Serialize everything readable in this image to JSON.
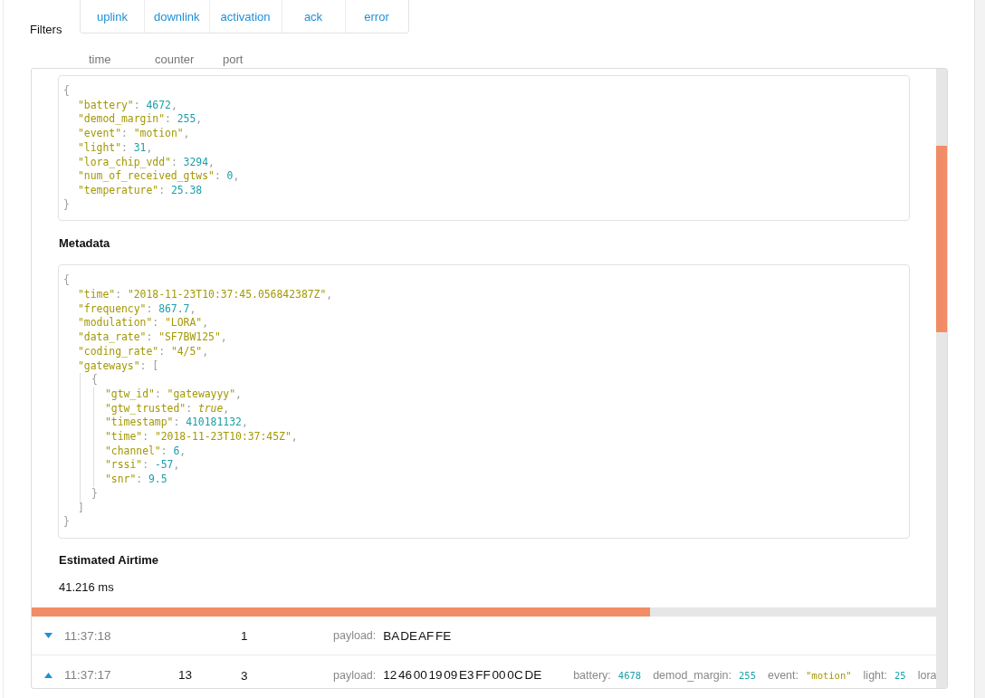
{
  "filters_label": "Filters",
  "filters": [
    {
      "label": "uplink",
      "selected": false
    },
    {
      "label": "downlink",
      "selected": false
    },
    {
      "label": "activation",
      "selected": false
    },
    {
      "label": "ack",
      "selected": false
    },
    {
      "label": "error",
      "selected": false
    }
  ],
  "columns": [
    "time",
    "counter",
    "port"
  ],
  "detail": {
    "payload_code": [
      {
        "tokens": [
          {
            "kind": "punct",
            "text": "{"
          }
        ]
      },
      {
        "children": [
          {
            "tokens": [
              {
                "kind": "key",
                "text": "\"battery\""
              },
              {
                "kind": "punct",
                "text": ": "
              },
              {
                "kind": "number",
                "text": "4672"
              },
              {
                "kind": "punct",
                "text": ","
              }
            ]
          },
          {
            "tokens": [
              {
                "kind": "key",
                "text": "\"demod_margin\""
              },
              {
                "kind": "punct",
                "text": ": "
              },
              {
                "kind": "number",
                "text": "255"
              },
              {
                "kind": "punct",
                "text": ","
              }
            ]
          },
          {
            "tokens": [
              {
                "kind": "key",
                "text": "\"event\""
              },
              {
                "kind": "punct",
                "text": ": "
              },
              {
                "kind": "string",
                "text": "\"motion\""
              },
              {
                "kind": "punct",
                "text": ","
              }
            ]
          },
          {
            "tokens": [
              {
                "kind": "key",
                "text": "\"light\""
              },
              {
                "kind": "punct",
                "text": ": "
              },
              {
                "kind": "number",
                "text": "31"
              },
              {
                "kind": "punct",
                "text": ","
              }
            ]
          },
          {
            "tokens": [
              {
                "kind": "key",
                "text": "\"lora_chip_vdd\""
              },
              {
                "kind": "punct",
                "text": ": "
              },
              {
                "kind": "number",
                "text": "3294"
              },
              {
                "kind": "punct",
                "text": ","
              }
            ]
          },
          {
            "tokens": [
              {
                "kind": "key",
                "text": "\"num_of_received_gtws\""
              },
              {
                "kind": "punct",
                "text": ": "
              },
              {
                "kind": "number",
                "text": "0"
              },
              {
                "kind": "punct",
                "text": ","
              }
            ]
          },
          {
            "tokens": [
              {
                "kind": "key",
                "text": "\"temperature\""
              },
              {
                "kind": "punct",
                "text": ": "
              },
              {
                "kind": "number",
                "text": "25.38"
              }
            ]
          }
        ]
      },
      {
        "tokens": [
          {
            "kind": "punct",
            "text": "}"
          }
        ]
      }
    ],
    "metadata": {
      "heading": "Metadata",
      "code": [
        {
          "tokens": [
            {
              "kind": "punct",
              "text": "{"
            }
          ]
        },
        {
          "children": [
            {
              "tokens": [
                {
                  "kind": "key",
                  "text": "\"time\""
                },
                {
                  "kind": "punct",
                  "text": ": "
                },
                {
                  "kind": "string",
                  "text": "\"2018-11-23T10:37:45.056842387Z\""
                },
                {
                  "kind": "punct",
                  "text": ","
                }
              ]
            },
            {
              "tokens": [
                {
                  "kind": "key",
                  "text": "\"frequency\""
                },
                {
                  "kind": "punct",
                  "text": ": "
                },
                {
                  "kind": "number",
                  "text": "867.7"
                },
                {
                  "kind": "punct",
                  "text": ","
                }
              ]
            },
            {
              "tokens": [
                {
                  "kind": "key",
                  "text": "\"modulation\""
                },
                {
                  "kind": "punct",
                  "text": ": "
                },
                {
                  "kind": "string",
                  "text": "\"LORA\""
                },
                {
                  "kind": "punct",
                  "text": ","
                }
              ]
            },
            {
              "tokens": [
                {
                  "kind": "key",
                  "text": "\"data_rate\""
                },
                {
                  "kind": "punct",
                  "text": ": "
                },
                {
                  "kind": "string",
                  "text": "\"SF7BW125\""
                },
                {
                  "kind": "punct",
                  "text": ","
                }
              ]
            },
            {
              "tokens": [
                {
                  "kind": "key",
                  "text": "\"coding_rate\""
                },
                {
                  "kind": "punct",
                  "text": ": "
                },
                {
                  "kind": "string",
                  "text": "\"4/5\""
                },
                {
                  "kind": "punct",
                  "text": ","
                }
              ]
            },
            {
              "tokens": [
                {
                  "kind": "key",
                  "text": "\"gateways\""
                },
                {
                  "kind": "punct",
                  "text": ": "
                },
                {
                  "kind": "punct",
                  "text": "["
                }
              ]
            },
            {
              "children": [
                {
                  "tokens": [
                    {
                      "kind": "punct",
                      "text": "{"
                    }
                  ]
                },
                {
                  "children": [
                    {
                      "tokens": [
                        {
                          "kind": "key",
                          "text": "\"gtw_id\""
                        },
                        {
                          "kind": "punct",
                          "text": ": "
                        },
                        {
                          "kind": "string",
                          "text": "\"gatewayyy\""
                        },
                        {
                          "kind": "punct",
                          "text": ","
                        }
                      ]
                    },
                    {
                      "tokens": [
                        {
                          "kind": "key",
                          "text": "\"gtw_trusted\""
                        },
                        {
                          "kind": "punct",
                          "text": ": "
                        },
                        {
                          "kind": "boolean",
                          "text": "true"
                        },
                        {
                          "kind": "punct",
                          "text": ","
                        }
                      ]
                    },
                    {
                      "tokens": [
                        {
                          "kind": "key",
                          "text": "\"timestamp\""
                        },
                        {
                          "kind": "punct",
                          "text": ": "
                        },
                        {
                          "kind": "number",
                          "text": "410181132"
                        },
                        {
                          "kind": "punct",
                          "text": ","
                        }
                      ]
                    },
                    {
                      "tokens": [
                        {
                          "kind": "key",
                          "text": "\"time\""
                        },
                        {
                          "kind": "punct",
                          "text": ": "
                        },
                        {
                          "kind": "string",
                          "text": "\"2018-11-23T10:37:45Z\""
                        },
                        {
                          "kind": "punct",
                          "text": ","
                        }
                      ]
                    },
                    {
                      "tokens": [
                        {
                          "kind": "key",
                          "text": "\"channel\""
                        },
                        {
                          "kind": "punct",
                          "text": ": "
                        },
                        {
                          "kind": "number",
                          "text": "6"
                        },
                        {
                          "kind": "punct",
                          "text": ","
                        }
                      ]
                    },
                    {
                      "tokens": [
                        {
                          "kind": "key",
                          "text": "\"rssi\""
                        },
                        {
                          "kind": "punct",
                          "text": ": "
                        },
                        {
                          "kind": "number",
                          "text": "-57"
                        },
                        {
                          "kind": "punct",
                          "text": ","
                        }
                      ]
                    },
                    {
                      "tokens": [
                        {
                          "kind": "key",
                          "text": "\"snr\""
                        },
                        {
                          "kind": "punct",
                          "text": ": "
                        },
                        {
                          "kind": "number",
                          "text": "9.5"
                        }
                      ]
                    }
                  ]
                },
                {
                  "tokens": [
                    {
                      "kind": "punct",
                      "text": "}"
                    }
                  ]
                }
              ]
            },
            {
              "tokens": [
                {
                  "kind": "punct",
                  "text": "]"
                }
              ]
            }
          ]
        },
        {
          "tokens": [
            {
              "kind": "punct",
              "text": "}"
            }
          ]
        }
      ]
    },
    "airtime": {
      "heading": "Estimated Airtime",
      "value": "41.216 ms"
    }
  },
  "rows": [
    {
      "expanded": false,
      "time": "11:37:18",
      "port": "1",
      "payload_label": "payload:",
      "payload": "BA DE AF FE"
    },
    {
      "expanded": true,
      "time": "11:37:17",
      "counter": "13",
      "port": "3",
      "payload_label": "payload:",
      "payload": "12 46 00 19 09 E3 FF 00 0C DE",
      "fields": [
        {
          "label": "battery:",
          "value": "4678",
          "kind": "number"
        },
        {
          "label": "demod_margin:",
          "value": "255",
          "kind": "number"
        },
        {
          "label": "event:",
          "value": "\"motion\"",
          "kind": "string"
        },
        {
          "label": "light:",
          "value": "25",
          "kind": "number"
        },
        {
          "label": "lora"
        }
      ]
    }
  ]
}
